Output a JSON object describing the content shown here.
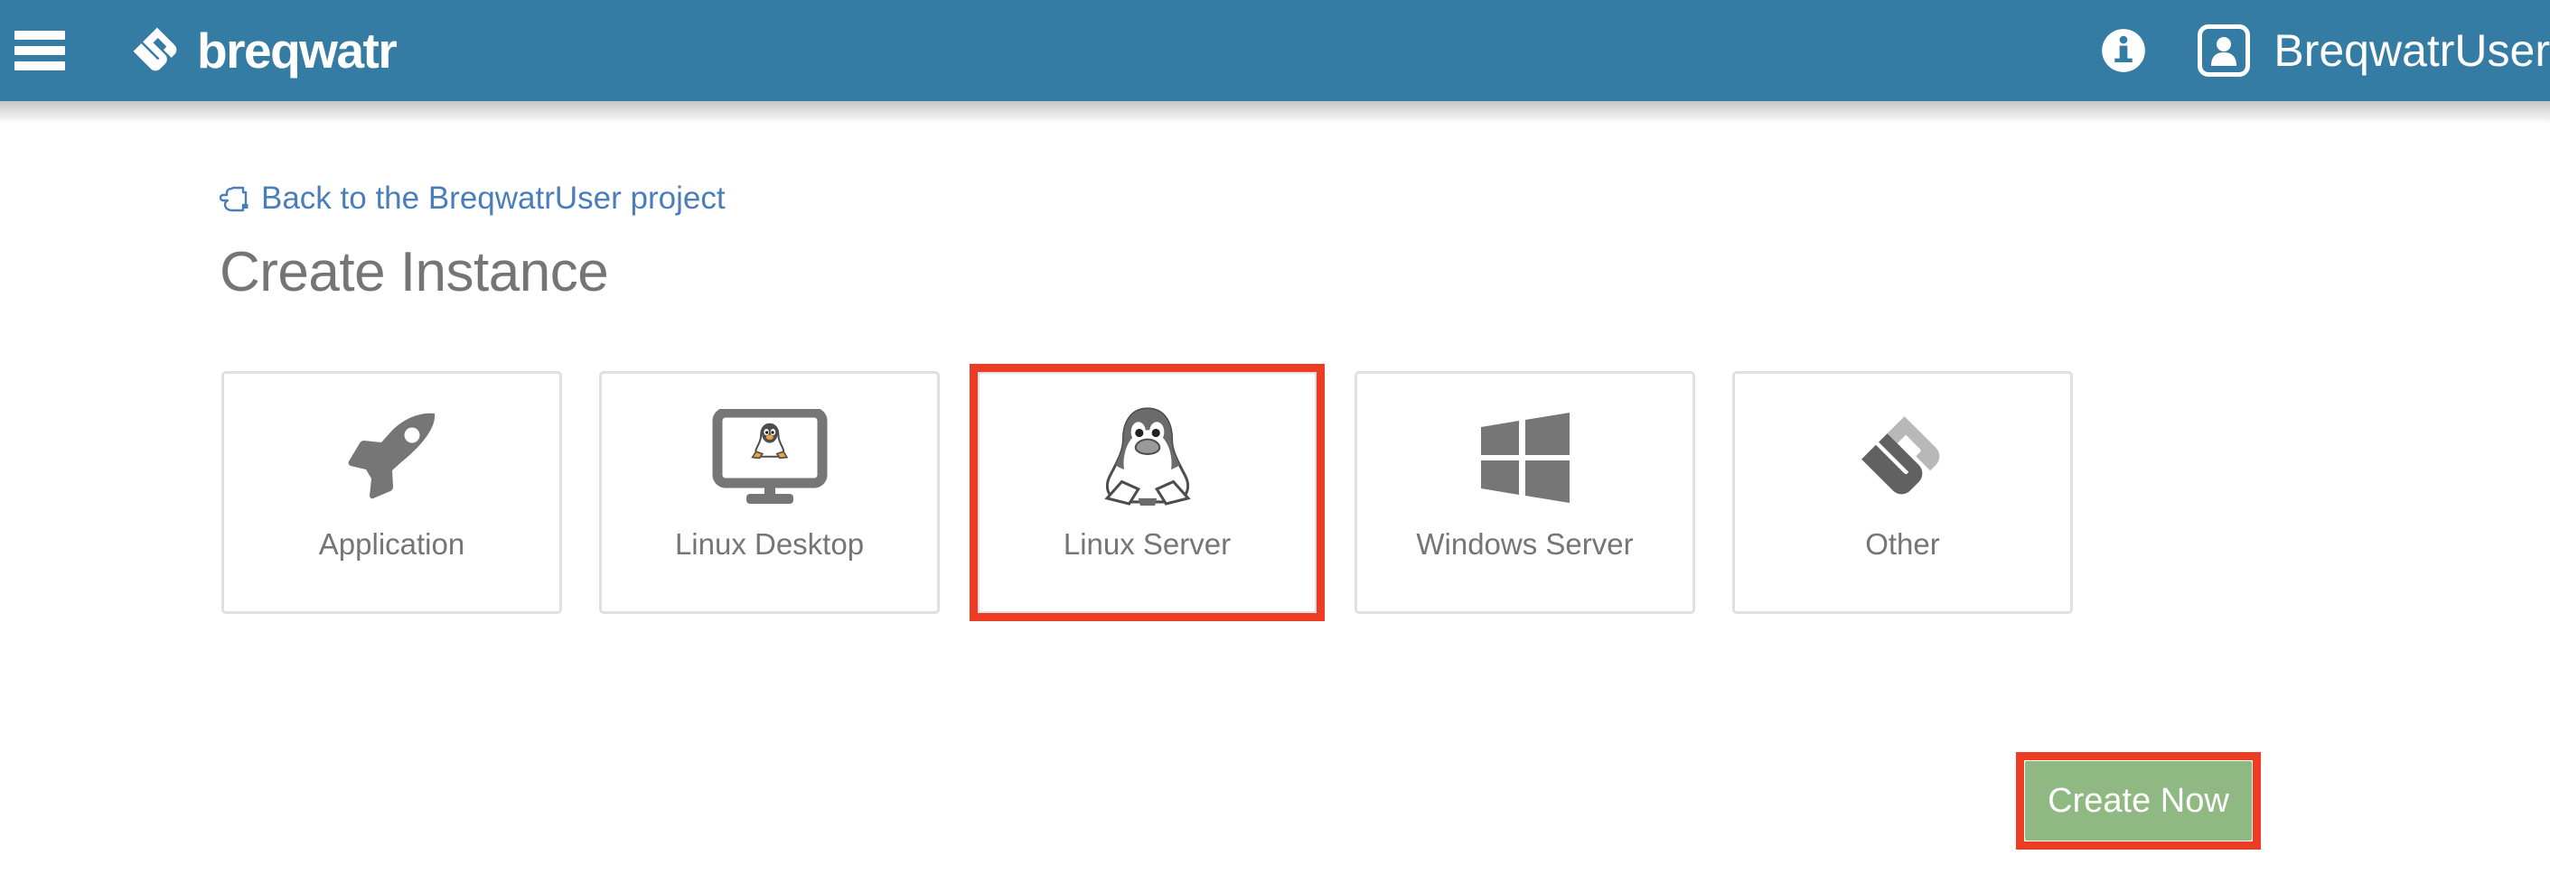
{
  "header": {
    "menu_icon": "hamburger-menu-icon",
    "brand_name": "breqwatr",
    "brand_logo_icon": "breqwatr-logo-mark",
    "info_icon": "info-circle-icon",
    "avatar_icon": "user-avatar-icon",
    "user_name": "BreqwatrUser",
    "bar_color": "#357ca5"
  },
  "breadcrumb": {
    "icon": "pointing-hand-left-icon",
    "label": "Back to the BreqwatrUser project",
    "link_color": "#4a7ebb"
  },
  "page": {
    "title": "Create Instance",
    "title_color": "#757575"
  },
  "cards": [
    {
      "label": "Application",
      "icon": "rocket-icon",
      "selected": false
    },
    {
      "label": "Linux Desktop",
      "icon": "monitor-tux-icon",
      "selected": false
    },
    {
      "label": "Linux Server",
      "icon": "tux-penguin-icon",
      "selected": true
    },
    {
      "label": "Windows Server",
      "icon": "windows-logo-icon",
      "selected": false
    },
    {
      "label": "Other",
      "icon": "breqwatr-mark-icon",
      "selected": false
    }
  ],
  "actions": {
    "create_label": "Create Now",
    "create_bg": "#8fb882",
    "highlight_color": "#ee3b24"
  }
}
